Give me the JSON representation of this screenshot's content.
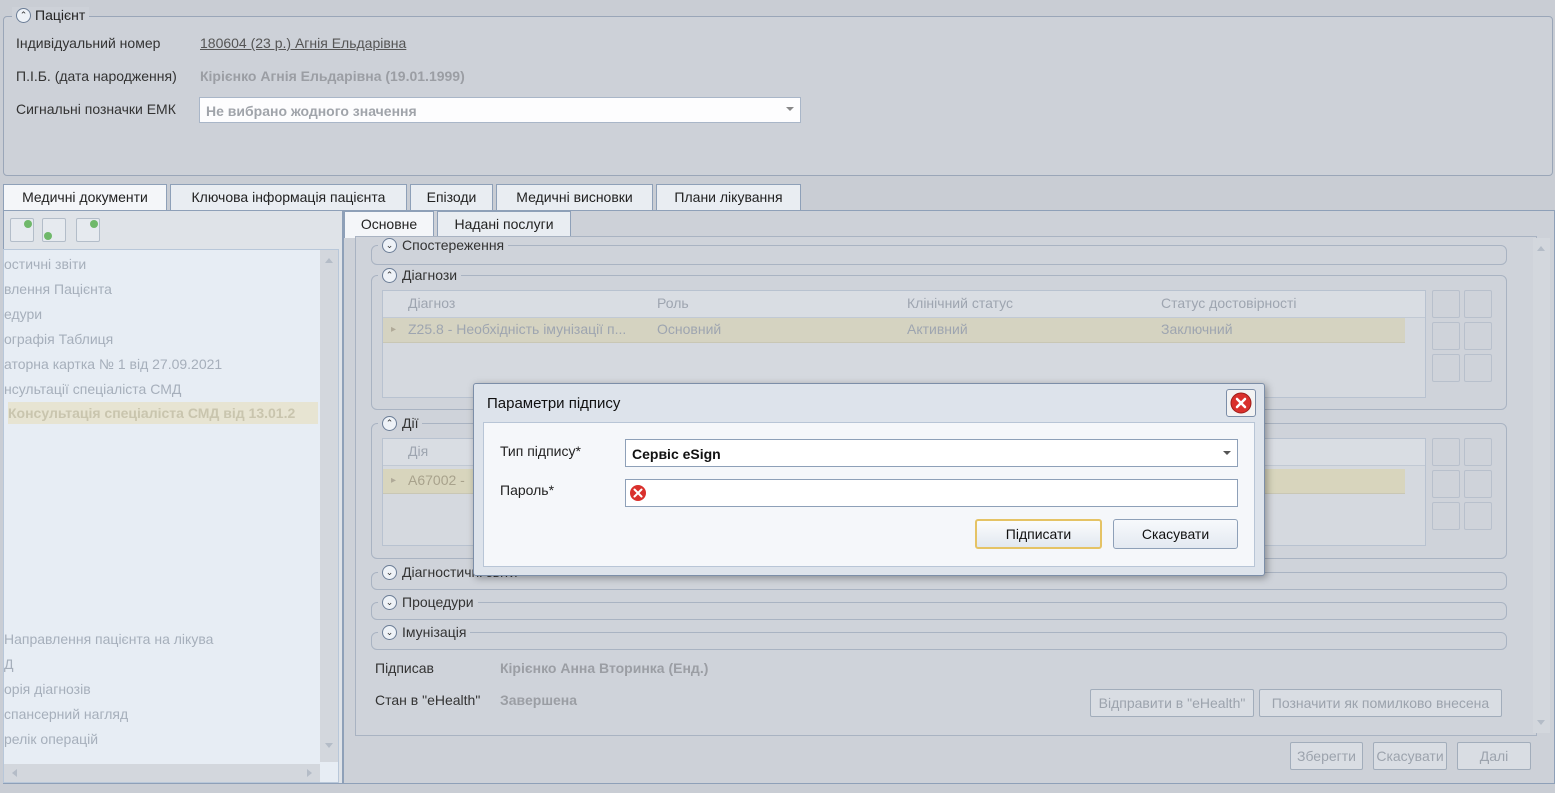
{
  "patient": {
    "legend": "Пацієнт",
    "id_label": "Індивідуальний номер",
    "id_value": "180604 (23 р.) Агнія Ельдарівна",
    "name_label": "П.І.Б. (дата народження)",
    "name_value": "Кірієнко Агнія Ельдарівна (19.01.1999)",
    "flags_label": "Сигнальні позначки ЕМК",
    "flags_value": "Не вибрано жодного значення"
  },
  "main_tabs": [
    "Медичні документи",
    "Ключова інформація пацієнта",
    "Епізоди",
    "Медичні висновки",
    "Плани лікування"
  ],
  "tree_items": [
    "остичні звіти",
    "влення Пацієнта",
    "едури",
    "ографія Таблиця",
    "аторна картка № 1 від 27.09.2021",
    "нсультації спеціаліста СМД",
    "Консультація спеціаліста СМД від 13.01.2",
    "Направлення пацієнта на лікува",
    "Д",
    "орія діагнозів",
    "спансерний нагляд",
    "релік операцій"
  ],
  "sub_tabs": [
    "Основне",
    "Надані послуги"
  ],
  "sections": {
    "observations": "Спостереження",
    "diagnoses": "Діагнози",
    "actions": "Дії",
    "diag_reports": "Діагностичні звіти",
    "procedures": "Процедури",
    "immunization": "Імунізація"
  },
  "diag_grid": {
    "headers": [
      "Діагноз",
      "Роль",
      "Клінічний статус",
      "Статус достовірності"
    ],
    "row": [
      "Z25.8 - Необхідність імунізації п...",
      "Основний",
      "Активний",
      "Заключний"
    ]
  },
  "actions_grid": {
    "header": "Дія",
    "row": "А67002 -"
  },
  "signed": {
    "label": "Підписав",
    "value": "Кірієнко Анна Вторинка (Енд.)"
  },
  "ehealth": {
    "label": "Стан в \"eHealth\"",
    "value": "Завершена",
    "send_button": "Відправити в \"eHealth\"",
    "mark_error_button": "Позначити як помилково внесена"
  },
  "footer": {
    "save": "Зберегти",
    "cancel": "Скасувати",
    "next": "Далі"
  },
  "dialog": {
    "title": "Параметри підпису",
    "type_label": "Тип підпису*",
    "type_value": "Сервіс eSign",
    "password_label": "Пароль*",
    "password_value": "",
    "sign_button": "Підписати",
    "cancel_button": "Скасувати"
  },
  "colors": {
    "accent_border": "#e5c365",
    "error_red": "#d9302c"
  }
}
